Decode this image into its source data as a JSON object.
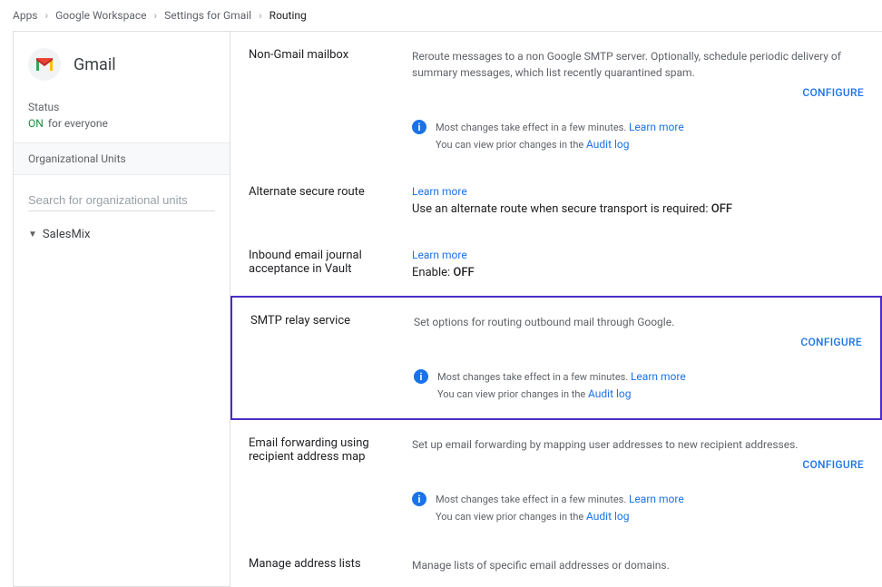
{
  "breadcrumb": {
    "items": [
      "Apps",
      "Google Workspace",
      "Settings for Gmail"
    ],
    "current": "Routing",
    "sep": "›"
  },
  "sidebar": {
    "app_name": "Gmail",
    "status_label": "Status",
    "status_value": "ON",
    "status_suffix": "for everyone",
    "ou_header": "Organizational Units",
    "ou_search_placeholder": "Search for organizational units",
    "ou_root": "SalesMix"
  },
  "strings": {
    "learn_more": "Learn more",
    "configure": "CONFIGURE",
    "info_line1": "Most changes take effect in a few minutes. ",
    "info_line2a": "You can view prior changes in the ",
    "audit_log": "Audit log"
  },
  "sections": {
    "non_gmail": {
      "title": "Non-Gmail mailbox",
      "desc": "Reroute messages to a non Google SMTP server. Optionally, schedule periodic delivery of summary messages, which list recently quarantined spam."
    },
    "alt_route": {
      "title": "Alternate secure route",
      "line_prefix": "Use an alternate route when secure transport is required: ",
      "line_value": "OFF"
    },
    "inbound_journal": {
      "title": "Inbound email journal acceptance in Vault",
      "line_prefix": "Enable: ",
      "line_value": "OFF"
    },
    "smtp_relay": {
      "title": "SMTP relay service",
      "desc": "Set options for routing outbound mail through Google."
    },
    "forwarding": {
      "title": "Email forwarding using recipient address map",
      "desc": "Set up email forwarding by mapping user addresses to new recipient addresses."
    },
    "manage_address": {
      "title": "Manage address lists",
      "desc": "Manage lists of specific email addresses or domains."
    }
  }
}
